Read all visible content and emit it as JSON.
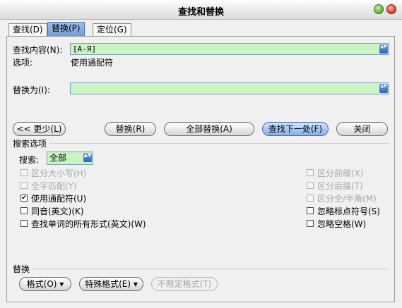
{
  "window": {
    "title": "查找和替换"
  },
  "tabs": [
    {
      "label": "查找(D)"
    },
    {
      "label": "替换(P)"
    },
    {
      "label": "定位(G)"
    }
  ],
  "find": {
    "label": "查找内容(N):",
    "value": "[А-Я]",
    "options_label": "选项:",
    "options_value": "使用通配符"
  },
  "replace": {
    "label": "替换为(I):",
    "value": ""
  },
  "buttons": {
    "less": "<< 更少(L)",
    "replace": "替换(R)",
    "replace_all": "全部替换(A)",
    "find_next": "查找下一处(F)",
    "close": "关闭"
  },
  "search_options": {
    "section_title": "搜索选项",
    "search_label": "搜索:",
    "search_value": "全部"
  },
  "checkboxes_left": [
    {
      "label": "区分大小写(H)",
      "checked": false,
      "enabled": false
    },
    {
      "label": "全字匹配(Y)",
      "checked": false,
      "enabled": false
    },
    {
      "label": "使用通配符(U)",
      "checked": true,
      "enabled": true
    },
    {
      "label": "同音(英文)(K)",
      "checked": false,
      "enabled": true
    },
    {
      "label": "查找单词的所有形式(英文)(W)",
      "checked": false,
      "enabled": true
    }
  ],
  "checkboxes_right": [
    {
      "label": "区分前缀(X)",
      "checked": false,
      "enabled": false
    },
    {
      "label": "区分后缀(T)",
      "checked": false,
      "enabled": false
    },
    {
      "label": "区分全/半角(M)",
      "checked": false,
      "enabled": false
    },
    {
      "label": "忽略标点符号(S)",
      "checked": false,
      "enabled": true
    },
    {
      "label": "忽略空格(W)",
      "checked": false,
      "enabled": true
    }
  ],
  "replace_section": {
    "title": "替换",
    "format_button": "格式(O) ▾",
    "special_button": "特殊格式(E) ▾",
    "no_format_button": "不限定格式(T)"
  },
  "marks": {
    "check": "✔",
    "spin": "▲▼"
  }
}
